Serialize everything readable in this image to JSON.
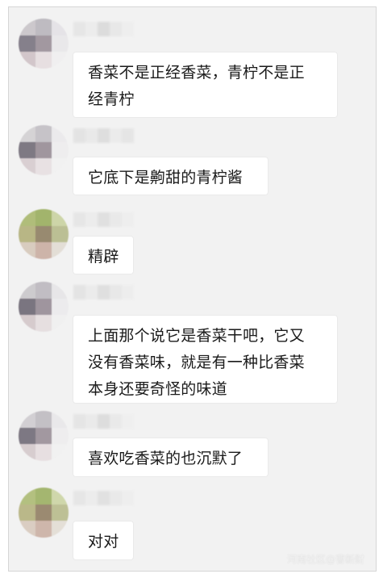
{
  "messages": [
    {
      "text": "香菜不是正经香菜，青柠不是正\n经青柠",
      "avatar": "avatar-gray"
    },
    {
      "text": "它底下是齁甜的青柠酱",
      "avatar": "avatar-gray"
    },
    {
      "text": "精辟",
      "avatar": "avatar-green"
    },
    {
      "text": "上面那个说它是香菜干吧，它又\n没有香菜味，就是有一种比香菜\n本身还要奇怪的味道",
      "avatar": "avatar-gray"
    },
    {
      "text": "喜欢吃香菜的也沉默了",
      "avatar": "avatar-gray"
    },
    {
      "text": "对对",
      "avatar": "avatar-green"
    }
  ],
  "watermark": "河南社区@曹新财",
  "colors": {
    "chat_background": "#f2f2f2",
    "bubble": "#ffffff",
    "text": "#1a1a1a"
  }
}
